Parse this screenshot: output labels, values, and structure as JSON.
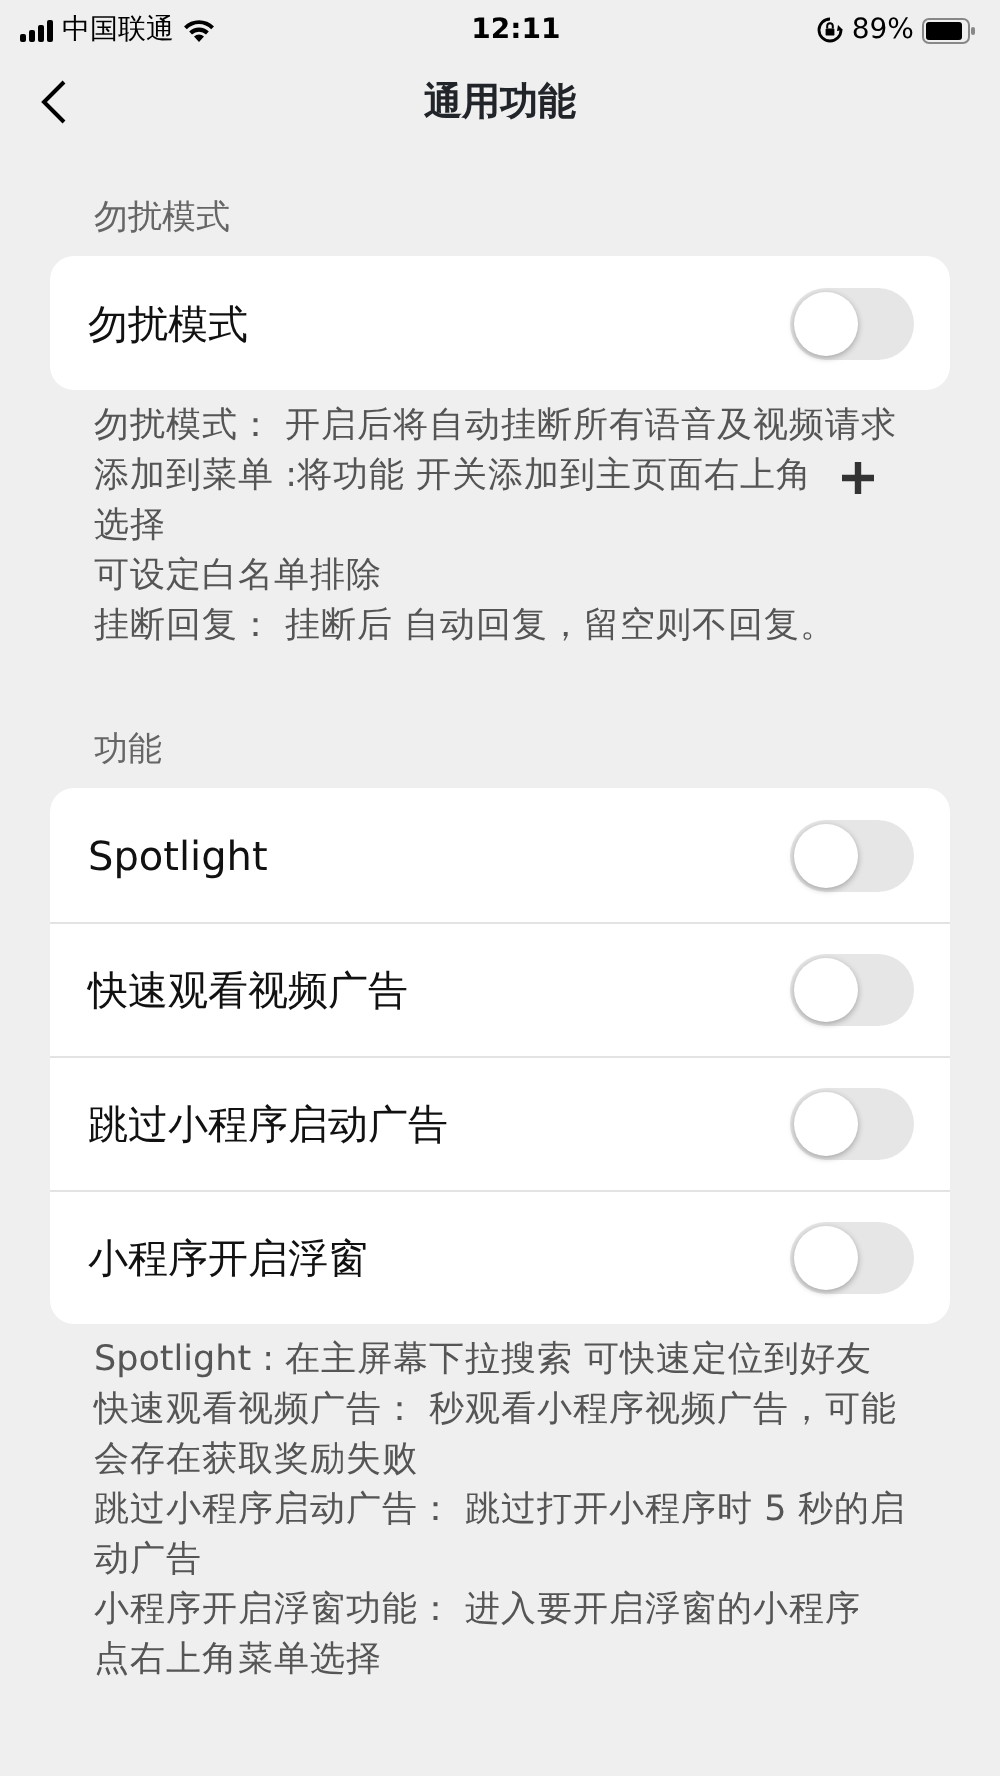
{
  "status_bar": {
    "carrier": "中国联通",
    "time": "12:11",
    "battery": "89%"
  },
  "nav": {
    "title": "通用功能"
  },
  "sections": [
    {
      "header": "勿扰模式",
      "rows": [
        {
          "label": "勿扰模式",
          "on": false
        }
      ],
      "notes": [
        {
          "text": "勿扰模式： 开启后将自动挂断所有语音及视频请求"
        },
        {
          "text": "添加到菜单 :将功能 开关添加到主页面右上角",
          "kind": "with_plus"
        },
        {
          "text": "选择"
        },
        {
          "text": "可设定白名单排除"
        },
        {
          "text": "挂断回复： 挂断后 自动回复，留空则不回复。"
        }
      ]
    },
    {
      "header": "功能",
      "rows": [
        {
          "label": "Spotlight",
          "on": false
        },
        {
          "label": "快速观看视频广告",
          "on": false
        },
        {
          "label": "跳过小程序启动广告",
          "on": false
        },
        {
          "label": "小程序开启浮窗",
          "on": false
        }
      ],
      "notes": [
        {
          "text": "Spotlight : 在主屏幕下拉搜索 可快速定位到好友"
        },
        {
          "text": "快速观看视频广告： 秒观看小程序视频广告，可能"
        },
        {
          "text": "会存在获取奖励失败"
        },
        {
          "text": "跳过小程序启动广告： 跳过打开小程序时 5 秒的启"
        },
        {
          "text": "动广告"
        },
        {
          "text": "小程序开启浮窗功能： 进入要开启浮窗的小程序"
        },
        {
          "text": "点右上角菜单选择"
        }
      ]
    }
  ]
}
